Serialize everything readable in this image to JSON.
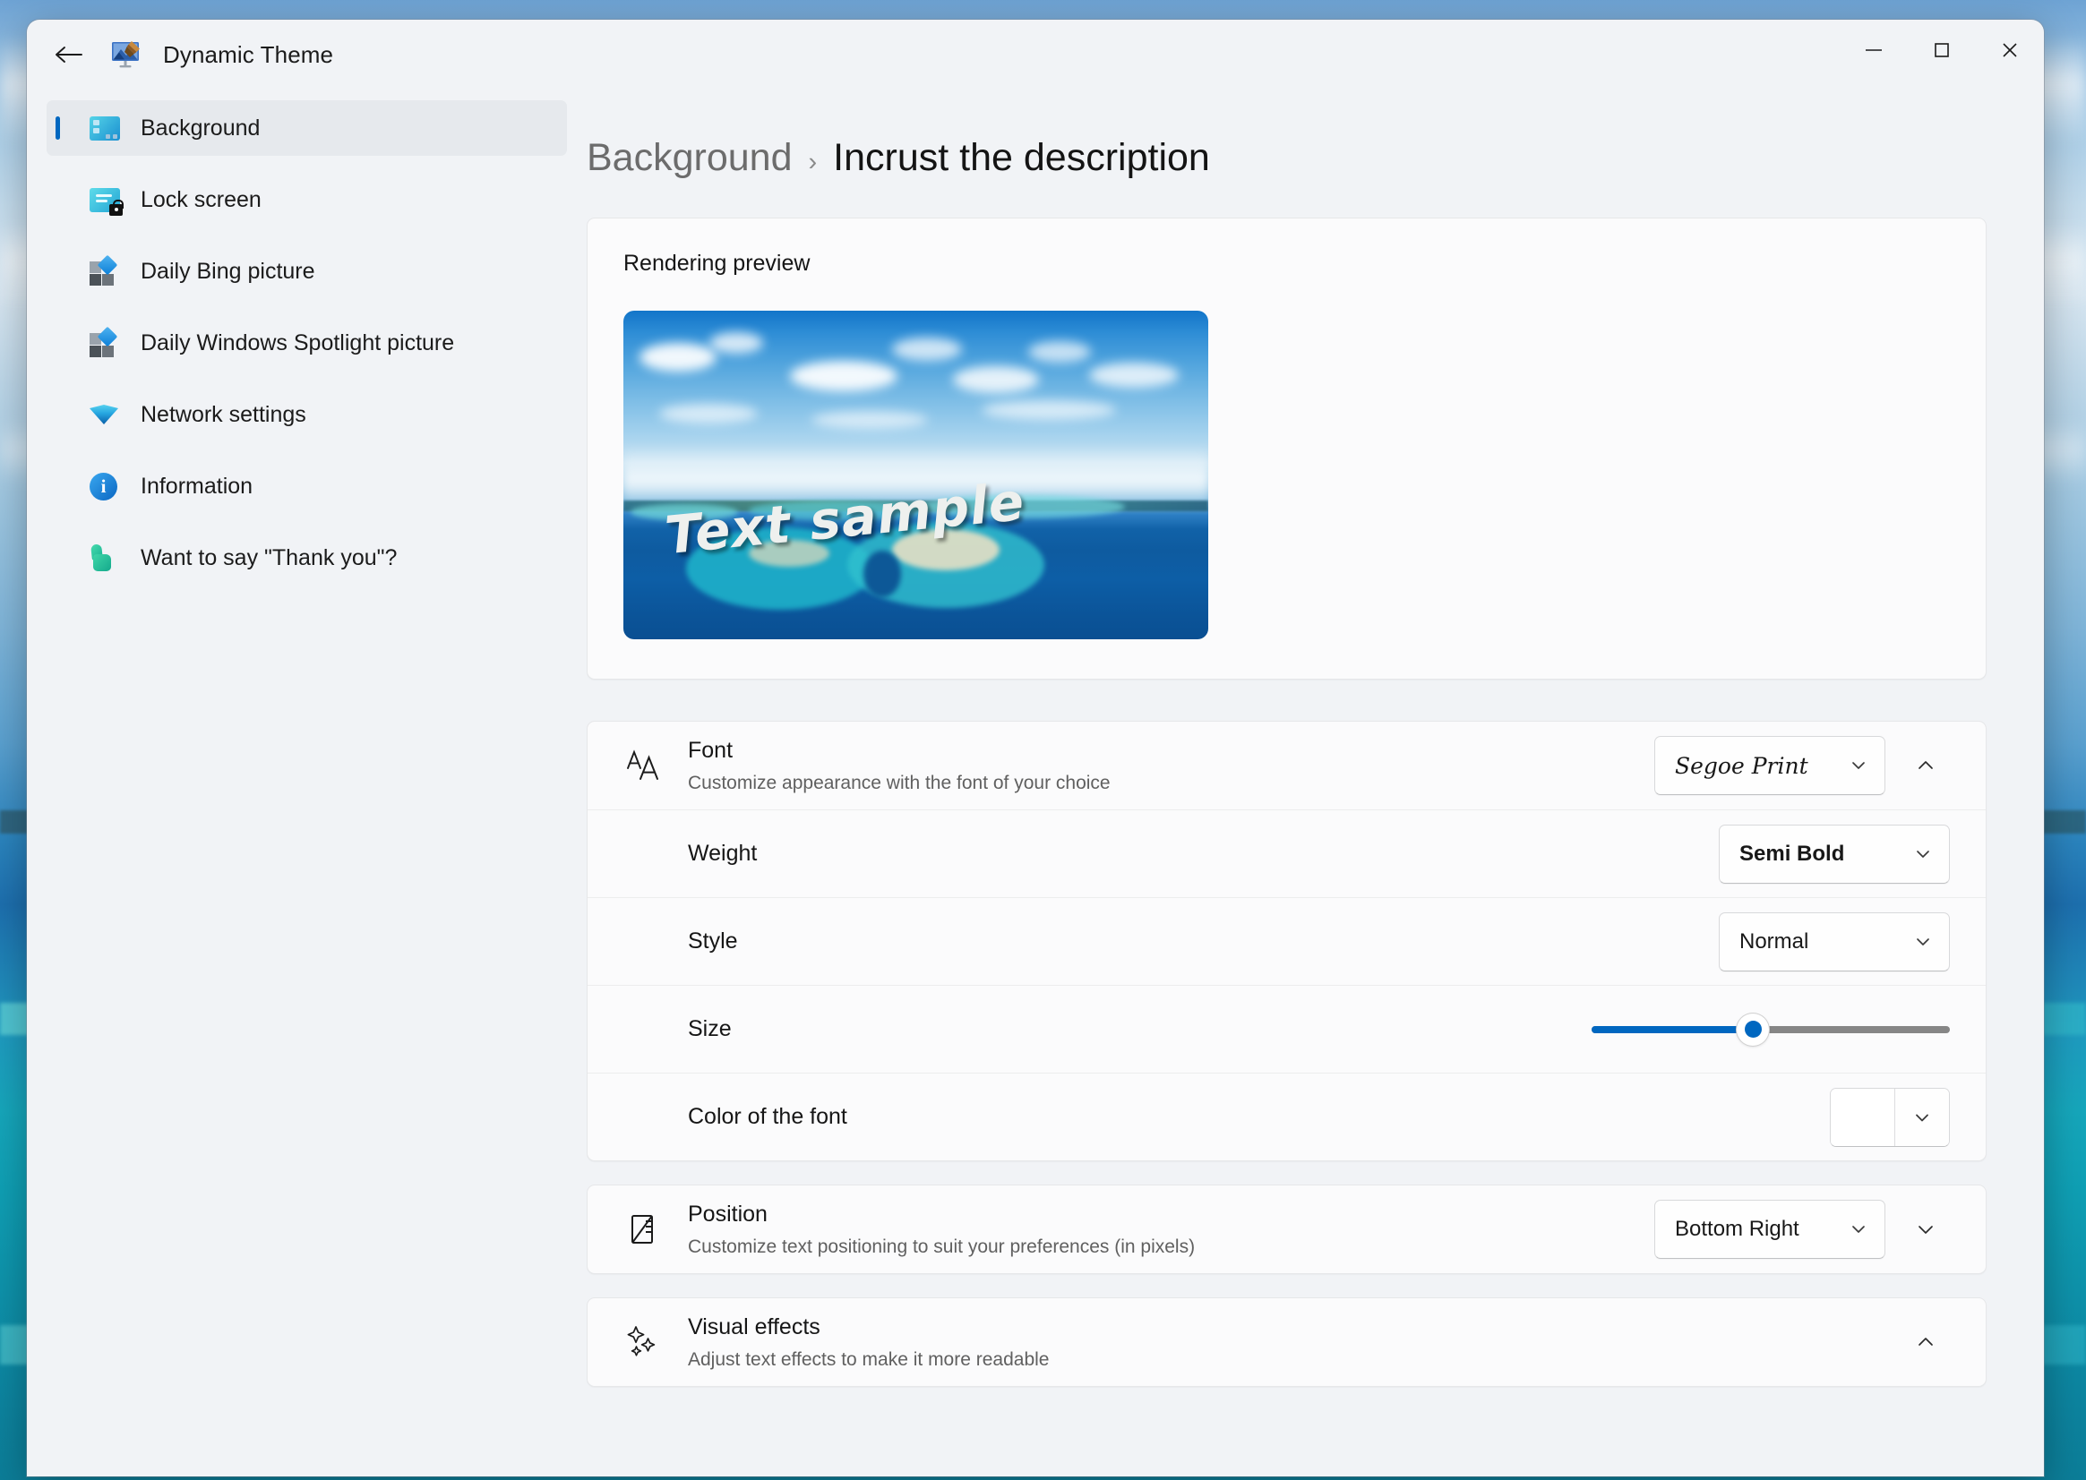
{
  "window": {
    "title": "Dynamic Theme",
    "back_label": "Back",
    "minimize_label": "Minimize",
    "maximize_label": "Maximize",
    "close_label": "Close"
  },
  "sidebar": {
    "items": [
      {
        "label": "Background",
        "icon": "desktop-background-icon",
        "selected": true
      },
      {
        "label": "Lock screen",
        "icon": "lock-screen-icon",
        "selected": false
      },
      {
        "label": "Daily Bing picture",
        "icon": "bing-tiles-icon",
        "selected": false
      },
      {
        "label": "Daily Windows Spotlight picture",
        "icon": "spotlight-tiles-icon",
        "selected": false
      },
      {
        "label": "Network settings",
        "icon": "wifi-icon",
        "selected": false
      },
      {
        "label": "Information",
        "icon": "info-icon",
        "selected": false
      },
      {
        "label": "Want to say \"Thank you\"?",
        "icon": "thumbs-up-icon",
        "selected": false
      }
    ]
  },
  "breadcrumb": {
    "parent": "Background",
    "separator": "›",
    "current": "Incrust the description"
  },
  "preview": {
    "title": "Rendering preview",
    "sample_text": "Text sample"
  },
  "settings": {
    "font": {
      "title": "Font",
      "subtitle": "Customize appearance with the font of your choice",
      "value": "Segoe Print",
      "expanded": true,
      "icon": "font-aa-icon"
    },
    "weight": {
      "title": "Weight",
      "value": "Semi Bold"
    },
    "style": {
      "title": "Style",
      "value": "Normal"
    },
    "size": {
      "title": "Size",
      "percent": 45
    },
    "color": {
      "title": "Color of the font",
      "swatch_hex": "#ffffff"
    },
    "position": {
      "title": "Position",
      "subtitle": "Customize text positioning to suit your preferences (in pixels)",
      "value": "Bottom Right",
      "expanded": false,
      "icon": "position-ruler-icon"
    },
    "effects": {
      "title": "Visual effects",
      "subtitle": "Adjust text effects to make it more readable",
      "expanded": true,
      "icon": "sparkle-icon"
    }
  },
  "colors": {
    "accent": "#0067c0",
    "selected_nav_bg": "#e6e9ed",
    "card_bg": "#fbfbfc",
    "window_bg": "#f1f3f6"
  }
}
